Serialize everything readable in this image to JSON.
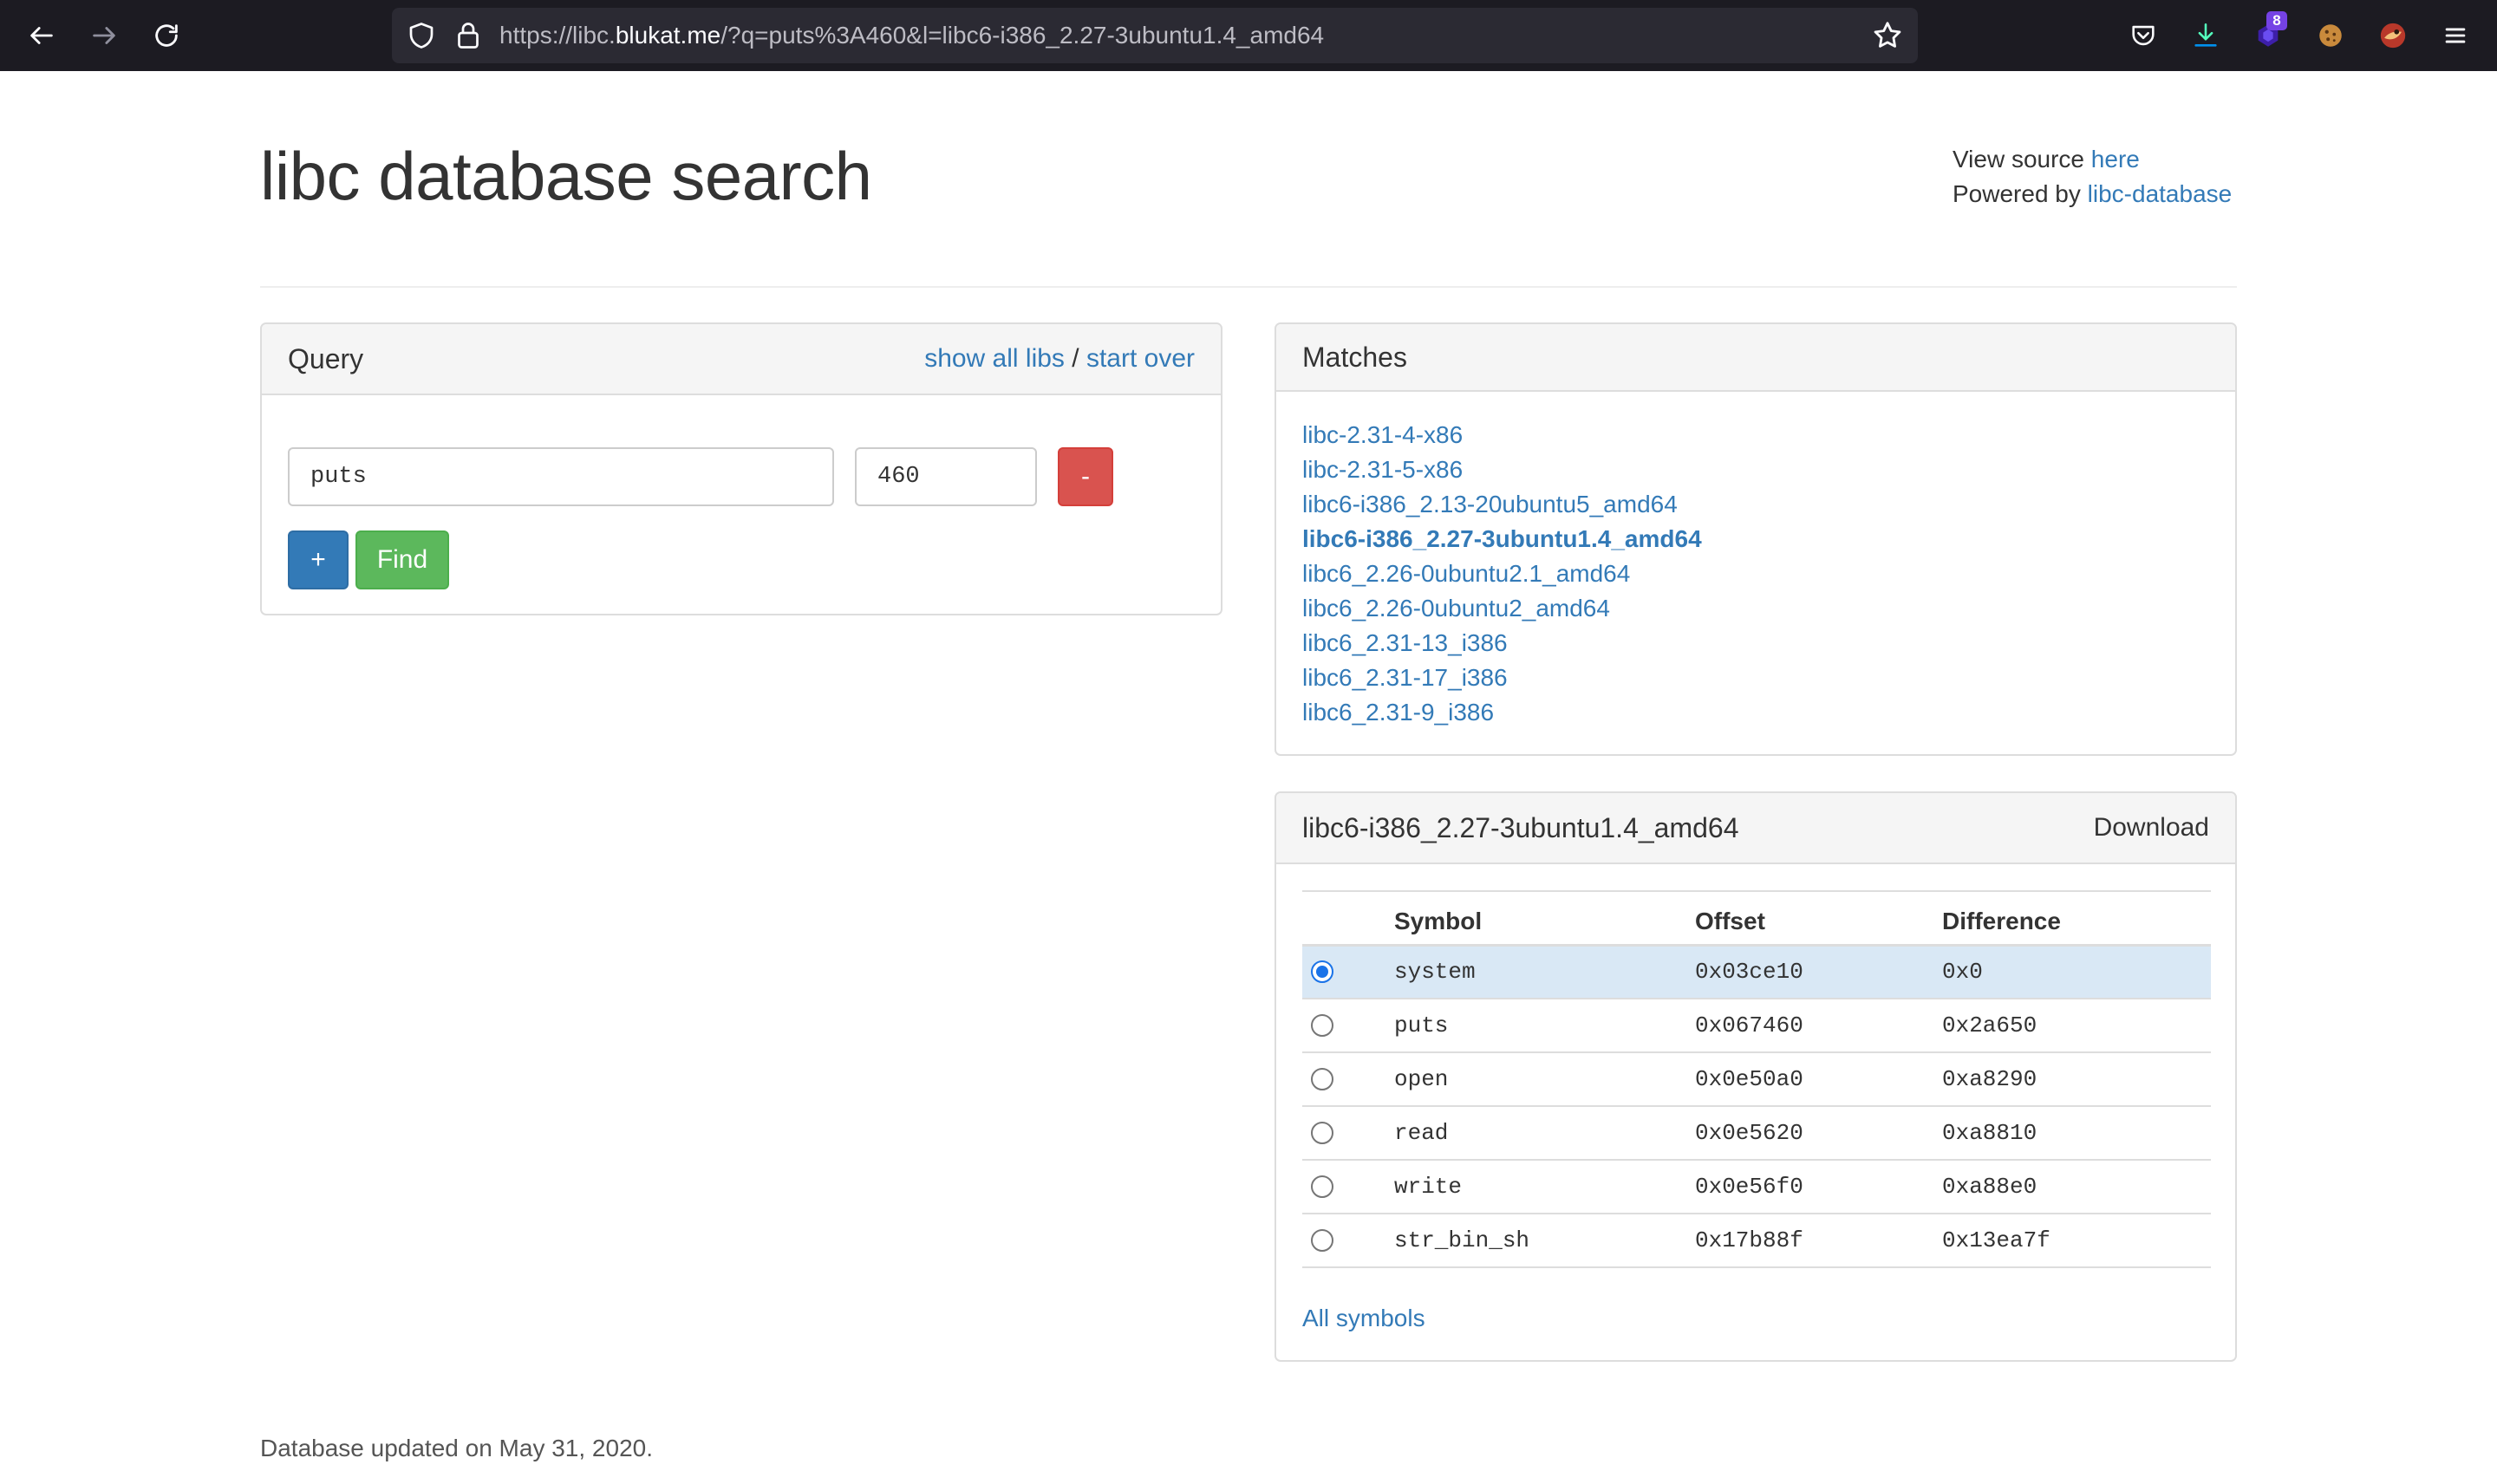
{
  "browser": {
    "url_prefix": "https://libc.",
    "url_host": "blukat.me",
    "url_rest": "/?q=puts%3A460&l=libc6-i386_2.27-3ubuntu1.4_amd64",
    "extension_badge": "8",
    "icons": [
      "back-arrow-icon",
      "forward-arrow-icon",
      "reload-icon",
      "shield-icon",
      "lock-icon",
      "bookmark-star-icon",
      "pocket-icon",
      "download-icon",
      "extension-icon",
      "cookie-icon",
      "avatar-icon",
      "hamburger-menu-icon"
    ]
  },
  "header": {
    "title": "libc database search",
    "view_source_prefix": "View source",
    "view_source_link": "here",
    "powered_by_prefix": "Powered by",
    "powered_by_link": "libc-database"
  },
  "query": {
    "title": "Query",
    "show_all_libs": "show all libs",
    "separator": "/",
    "start_over": "start over",
    "symbol_value": "puts",
    "address_value": "460",
    "remove_label": "-",
    "add_label": "+",
    "find_label": "Find"
  },
  "matches": {
    "title": "Matches",
    "items": [
      {
        "label": "libc-2.31-4-x86",
        "active": false
      },
      {
        "label": "libc-2.31-5-x86",
        "active": false
      },
      {
        "label": "libc6-i386_2.13-20ubuntu5_amd64",
        "active": false
      },
      {
        "label": "libc6-i386_2.27-3ubuntu1.4_amd64",
        "active": true
      },
      {
        "label": "libc6_2.26-0ubuntu2.1_amd64",
        "active": false
      },
      {
        "label": "libc6_2.26-0ubuntu2_amd64",
        "active": false
      },
      {
        "label": "libc6_2.31-13_i386",
        "active": false
      },
      {
        "label": "libc6_2.31-17_i386",
        "active": false
      },
      {
        "label": "libc6_2.31-9_i386",
        "active": false
      }
    ]
  },
  "detail": {
    "title": "libc6-i386_2.27-3ubuntu1.4_amd64",
    "download": "Download",
    "columns": [
      "Symbol",
      "Offset",
      "Difference"
    ],
    "rows": [
      {
        "symbol": "system",
        "offset": "0x03ce10",
        "difference": "0x0",
        "selected": true
      },
      {
        "symbol": "puts",
        "offset": "0x067460",
        "difference": "0x2a650",
        "selected": false
      },
      {
        "symbol": "open",
        "offset": "0x0e50a0",
        "difference": "0xa8290",
        "selected": false
      },
      {
        "symbol": "read",
        "offset": "0x0e5620",
        "difference": "0xa8810",
        "selected": false
      },
      {
        "symbol": "write",
        "offset": "0x0e56f0",
        "difference": "0xa88e0",
        "selected": false
      },
      {
        "symbol": "str_bin_sh",
        "offset": "0x17b88f",
        "difference": "0x13ea7f",
        "selected": false
      }
    ],
    "all_symbols": "All symbols"
  },
  "footer": {
    "text": "Database updated on May 31, 2020."
  },
  "colors": {
    "link": "#337ab7",
    "danger": "#d9534f",
    "primary": "#337ab7",
    "success": "#5cb85c",
    "selected_row": "#d9e8f5"
  }
}
